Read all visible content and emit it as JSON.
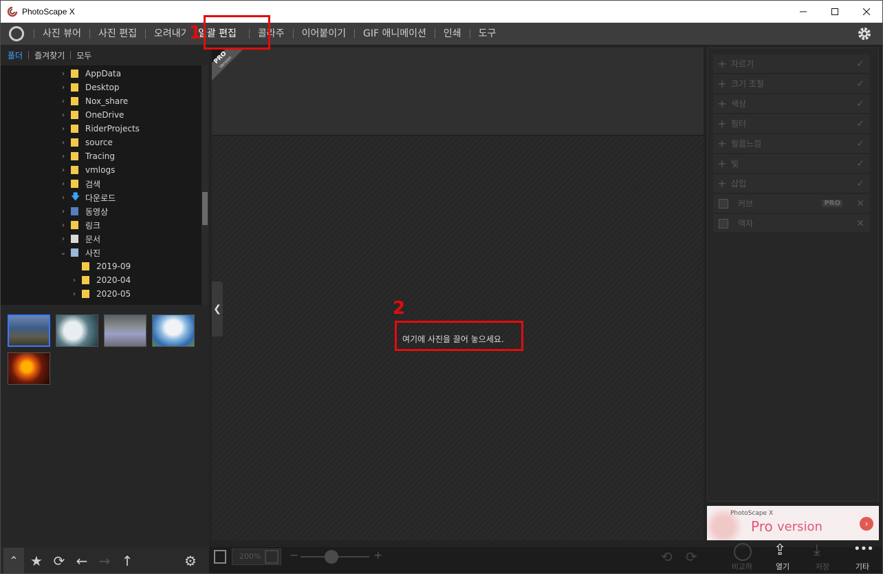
{
  "window": {
    "title": "PhotoScape X"
  },
  "nav": {
    "items": [
      "사진 뷰어",
      "사진 편집",
      "오려내기",
      "일괄 편집",
      "콜라주",
      "이어붙이기",
      "GIF 애니메이션",
      "인쇄",
      "도구"
    ]
  },
  "left": {
    "tabs": [
      "폴더",
      "즐겨찾기",
      "모두"
    ],
    "tree": [
      {
        "label": "AppData",
        "icon": "folder-icon"
      },
      {
        "label": "Desktop",
        "icon": "folder-icon"
      },
      {
        "label": "Nox_share",
        "icon": "folder-icon"
      },
      {
        "label": "OneDrive",
        "icon": "onedrive-folder-icon"
      },
      {
        "label": "RiderProjects",
        "icon": "folder-icon"
      },
      {
        "label": "source",
        "icon": "folder-icon"
      },
      {
        "label": "Tracing",
        "icon": "folder-icon"
      },
      {
        "label": "vmlogs",
        "icon": "folder-icon"
      },
      {
        "label": "검색",
        "icon": "search-folder-icon"
      },
      {
        "label": "다운로드",
        "icon": "download-icon"
      },
      {
        "label": "동영상",
        "icon": "video-folder-icon"
      },
      {
        "label": "링크",
        "icon": "links-folder-icon"
      },
      {
        "label": "문서",
        "icon": "documents-icon"
      },
      {
        "label": "사진",
        "icon": "pictures-icon"
      },
      {
        "label": "2019-09",
        "icon": "folder-icon"
      },
      {
        "label": "2020-04",
        "icon": "folder-icon"
      },
      {
        "label": "2020-05",
        "icon": "folder-icon"
      }
    ]
  },
  "center": {
    "pro_badge": "PRO",
    "pro_badge_sub": "Version",
    "drop_hint": "여기에 사진을 끌어 놓으세요."
  },
  "right": {
    "tools": [
      "자르기",
      "크기 조절",
      "색상",
      "필터",
      "필름느낌",
      "빛",
      "삽입"
    ],
    "options": [
      "커브",
      "액자"
    ],
    "pro_tag": "PRO",
    "ad_brand": "PhotoScape X",
    "ad_pro": "Pro",
    "ad_version": "version"
  },
  "bottom": {
    "zoom": "200%",
    "compare_label": "비교하기",
    "open_label": "열기",
    "save_label": "저장",
    "more_label": "기타"
  },
  "annotations": {
    "one": "1",
    "two": "2"
  },
  "colors": {
    "accent": "#3da3ff",
    "highlight": "#e30c0c",
    "folder": "#f4c94b"
  }
}
